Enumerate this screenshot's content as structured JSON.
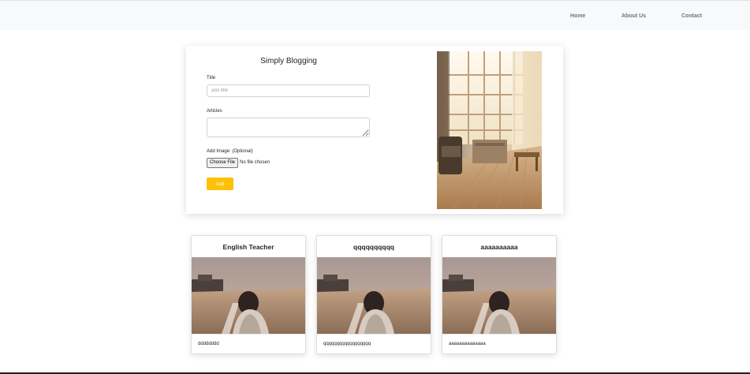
{
  "nav": {
    "home": "Home",
    "about": "About Us",
    "contact": "Contact"
  },
  "form": {
    "heading": "Simply Blogging",
    "title_label": "Title",
    "title_placeholder": "add title",
    "title_value": "",
    "articles_label": "Articles",
    "articles_value": "",
    "image_label": "Add Image: (Optional)",
    "choose_file_label": "Choose File",
    "file_status": "No file chosen",
    "submit_label": "Add"
  },
  "posts": [
    {
      "title": "English Teacher",
      "body": "dddddddd"
    },
    {
      "title": "qqqqqqqqqq",
      "body": "qqqqqqqqqqqqqqqqqq"
    },
    {
      "title": "aaaaaaaaaa",
      "body": "aaaaaaaaaaaaaa"
    }
  ],
  "colors": {
    "navbar_bg": "#f8f9fa",
    "accent": "#ffc107",
    "nav_link": "#6c757d"
  }
}
